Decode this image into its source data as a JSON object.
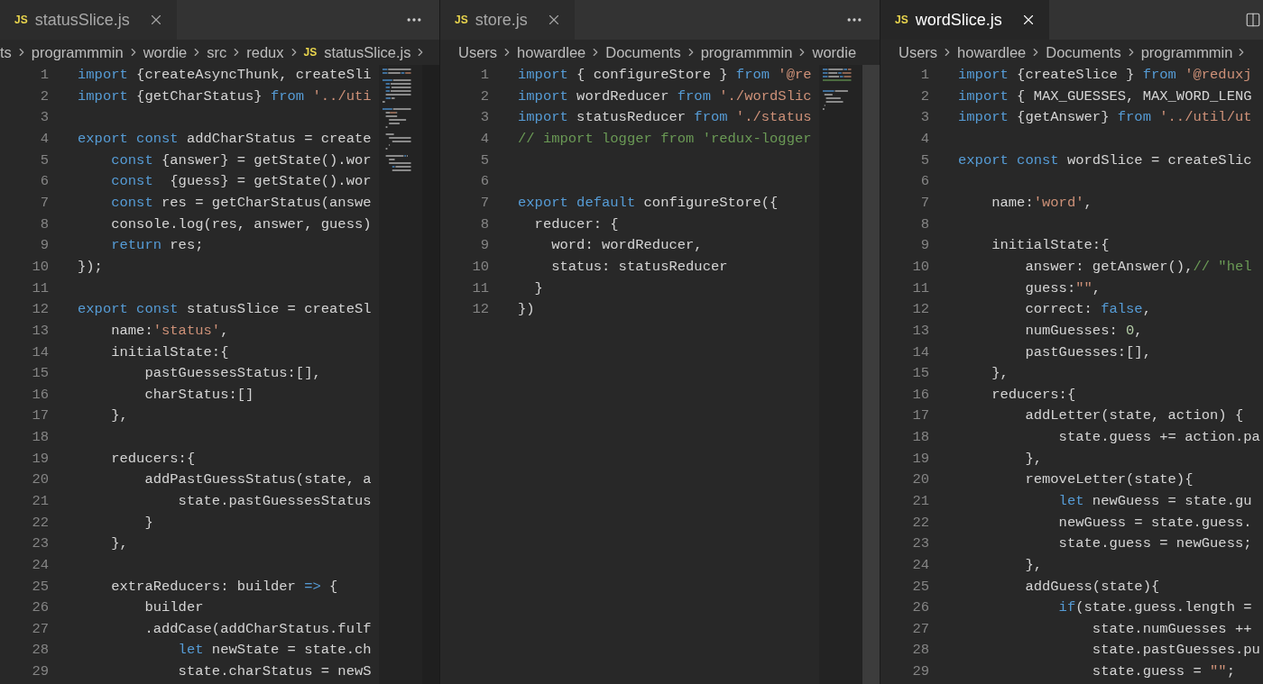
{
  "panes": [
    {
      "tab": {
        "badge": "JS",
        "label": "statusSlice.js",
        "focused": false
      },
      "action": {
        "kind": "more"
      },
      "minimap": true,
      "breadcrumb": [
        {
          "text": "ts"
        },
        {
          "text": "programmmin"
        },
        {
          "text": "wordie"
        },
        {
          "text": "src"
        },
        {
          "text": "redux"
        },
        {
          "text": "statusSlice.js",
          "kind": "file",
          "badge": "JS"
        }
      ],
      "trailing_chevron": true,
      "lines": [
        {
          "number": "1",
          "tokens": [
            {
              "kind": "keyword",
              "text": "import"
            },
            {
              "kind": "plain",
              "text": " {createAsyncThunk, createSli"
            }
          ]
        },
        {
          "number": "2",
          "tokens": [
            {
              "kind": "keyword",
              "text": "import"
            },
            {
              "kind": "plain",
              "text": " {getCharStatus} "
            },
            {
              "kind": "keyword",
              "text": "from"
            },
            {
              "kind": "string",
              "text": " '../uti"
            }
          ]
        },
        {
          "number": "3"
        },
        {
          "number": "4",
          "tokens": [
            {
              "kind": "keyword",
              "text": "export const"
            },
            {
              "kind": "plain",
              "text": " addCharStatus = create"
            }
          ]
        },
        {
          "number": "5",
          "tokens": [
            {
              "kind": "keyword",
              "text": "    const"
            },
            {
              "kind": "plain",
              "text": " {answer} = getState().wor"
            }
          ]
        },
        {
          "number": "6",
          "tokens": [
            {
              "kind": "keyword",
              "text": "    const"
            },
            {
              "kind": "plain",
              "text": "  {guess} = getState().wor"
            }
          ]
        },
        {
          "number": "7",
          "tokens": [
            {
              "kind": "keyword",
              "text": "    const"
            },
            {
              "kind": "plain",
              "text": " res = getCharStatus(answe"
            }
          ]
        },
        {
          "number": "8",
          "tokens": [
            {
              "kind": "plain",
              "text": "    console.log(res, answer, guess)"
            }
          ]
        },
        {
          "number": "9",
          "tokens": [
            {
              "kind": "keyword",
              "text": "    return"
            },
            {
              "kind": "plain",
              "text": " res;"
            }
          ]
        },
        {
          "number": "10",
          "tokens": [
            {
              "kind": "plain",
              "text": "});"
            }
          ]
        },
        {
          "number": "11"
        },
        {
          "number": "12",
          "tokens": [
            {
              "kind": "keyword",
              "text": "export const"
            },
            {
              "kind": "plain",
              "text": " statusSlice = createSl"
            }
          ]
        },
        {
          "number": "13",
          "tokens": [
            {
              "kind": "plain",
              "text": "    name:"
            },
            {
              "kind": "string",
              "text": "'status'"
            },
            {
              "kind": "plain",
              "text": ","
            }
          ]
        },
        {
          "number": "14",
          "tokens": [
            {
              "kind": "plain",
              "text": "    initialState:{"
            }
          ]
        },
        {
          "number": "15",
          "tokens": [
            {
              "kind": "plain",
              "text": "        pastGuessesStatus:[],"
            }
          ]
        },
        {
          "number": "16",
          "tokens": [
            {
              "kind": "plain",
              "text": "        charStatus:[]"
            }
          ]
        },
        {
          "number": "17",
          "tokens": [
            {
              "kind": "plain",
              "text": "    },"
            }
          ]
        },
        {
          "number": "18"
        },
        {
          "number": "19",
          "tokens": [
            {
              "kind": "plain",
              "text": "    reducers:{"
            }
          ]
        },
        {
          "number": "20",
          "tokens": [
            {
              "kind": "plain",
              "text": "        addPastGuessStatus(state, a"
            }
          ]
        },
        {
          "number": "21",
          "tokens": [
            {
              "kind": "plain",
              "text": "            state.pastGuessesStatus"
            }
          ]
        },
        {
          "number": "22",
          "tokens": [
            {
              "kind": "plain",
              "text": "        }"
            }
          ]
        },
        {
          "number": "23",
          "tokens": [
            {
              "kind": "plain",
              "text": "    },"
            }
          ]
        },
        {
          "number": "24"
        },
        {
          "number": "25",
          "tokens": [
            {
              "kind": "plain",
              "text": "    extraReducers: builder "
            },
            {
              "kind": "keyword",
              "text": "=>"
            },
            {
              "kind": "plain",
              "text": " {"
            }
          ]
        },
        {
          "number": "26",
          "tokens": [
            {
              "kind": "plain",
              "text": "        builder"
            }
          ]
        },
        {
          "number": "27",
          "tokens": [
            {
              "kind": "plain",
              "text": "        .addCase(addCharStatus.fulf"
            }
          ]
        },
        {
          "number": "28",
          "tokens": [
            {
              "kind": "keyword",
              "text": "            let"
            },
            {
              "kind": "plain",
              "text": " newState = state.ch"
            }
          ]
        },
        {
          "number": "29",
          "tokens": [
            {
              "kind": "plain",
              "text": "            state.charStatus = newS"
            }
          ]
        }
      ]
    },
    {
      "tab": {
        "badge": "JS",
        "label": "store.js",
        "focused": false
      },
      "action": {
        "kind": "more"
      },
      "minimap": true,
      "breadcrumb": [
        {
          "text": "Users"
        },
        {
          "text": "howardlee"
        },
        {
          "text": "Documents"
        },
        {
          "text": "programmmin"
        },
        {
          "text": "wordie"
        }
      ],
      "trailing_chevron": false,
      "lines": [
        {
          "number": "1",
          "tokens": [
            {
              "kind": "keyword",
              "text": "import"
            },
            {
              "kind": "plain",
              "text": " { configureStore } "
            },
            {
              "kind": "keyword",
              "text": "from"
            },
            {
              "kind": "string",
              "text": " '@re"
            }
          ]
        },
        {
          "number": "2",
          "tokens": [
            {
              "kind": "keyword",
              "text": "import"
            },
            {
              "kind": "plain",
              "text": " wordReducer "
            },
            {
              "kind": "keyword",
              "text": "from"
            },
            {
              "kind": "string",
              "text": " './wordSlic"
            }
          ]
        },
        {
          "number": "3",
          "tokens": [
            {
              "kind": "keyword",
              "text": "import"
            },
            {
              "kind": "plain",
              "text": " statusReducer "
            },
            {
              "kind": "keyword",
              "text": "from"
            },
            {
              "kind": "string",
              "text": " './status"
            }
          ]
        },
        {
          "number": "4",
          "tokens": [
            {
              "kind": "comment",
              "text": "// import logger from 'redux-logger"
            }
          ]
        },
        {
          "number": "5"
        },
        {
          "number": "6"
        },
        {
          "number": "7",
          "tokens": [
            {
              "kind": "keyword",
              "text": "export default"
            },
            {
              "kind": "plain",
              "text": " configureStore({"
            }
          ]
        },
        {
          "number": "8",
          "tokens": [
            {
              "kind": "plain",
              "text": "  reducer: {"
            }
          ]
        },
        {
          "number": "9",
          "tokens": [
            {
              "kind": "plain",
              "text": "    word: wordReducer,"
            }
          ]
        },
        {
          "number": "10",
          "tokens": [
            {
              "kind": "plain",
              "text": "    status: statusReducer"
            }
          ]
        },
        {
          "number": "11",
          "tokens": [
            {
              "kind": "plain",
              "text": "  }"
            }
          ]
        },
        {
          "number": "12",
          "tokens": [
            {
              "kind": "plain",
              "text": "})"
            }
          ]
        }
      ]
    },
    {
      "tab": {
        "badge": "JS",
        "label": "wordSlice.js",
        "focused": true
      },
      "action": {
        "kind": "split"
      },
      "minimap": false,
      "breadcrumb": [
        {
          "text": "Users"
        },
        {
          "text": "howardlee"
        },
        {
          "text": "Documents"
        },
        {
          "text": "programmmin"
        }
      ],
      "trailing_chevron": true,
      "lines": [
        {
          "number": "1",
          "tokens": [
            {
              "kind": "keyword",
              "text": "import"
            },
            {
              "kind": "plain",
              "text": " {createSlice } "
            },
            {
              "kind": "keyword",
              "text": "from"
            },
            {
              "kind": "string",
              "text": " '@reduxj"
            }
          ]
        },
        {
          "number": "2",
          "tokens": [
            {
              "kind": "keyword",
              "text": "import"
            },
            {
              "kind": "plain",
              "text": " { MAX_GUESSES, MAX_WORD_LENG"
            }
          ]
        },
        {
          "number": "3",
          "tokens": [
            {
              "kind": "keyword",
              "text": "import"
            },
            {
              "kind": "plain",
              "text": " {getAnswer} "
            },
            {
              "kind": "keyword",
              "text": "from"
            },
            {
              "kind": "string",
              "text": " '../util/ut"
            }
          ]
        },
        {
          "number": "4"
        },
        {
          "number": "5",
          "tokens": [
            {
              "kind": "keyword",
              "text": "export const"
            },
            {
              "kind": "plain",
              "text": " wordSlice = createSlic"
            }
          ]
        },
        {
          "number": "6"
        },
        {
          "number": "7",
          "tokens": [
            {
              "kind": "plain",
              "text": "    name:"
            },
            {
              "kind": "string",
              "text": "'word'"
            },
            {
              "kind": "plain",
              "text": ","
            }
          ]
        },
        {
          "number": "8"
        },
        {
          "number": "9",
          "tokens": [
            {
              "kind": "plain",
              "text": "    initialState:{"
            }
          ]
        },
        {
          "number": "10",
          "tokens": [
            {
              "kind": "plain",
              "text": "        answer: getAnswer(),"
            },
            {
              "kind": "comment",
              "text": "// \"hel"
            }
          ]
        },
        {
          "number": "11",
          "tokens": [
            {
              "kind": "plain",
              "text": "        guess:"
            },
            {
              "kind": "string",
              "text": "\"\""
            },
            {
              "kind": "plain",
              "text": ","
            }
          ]
        },
        {
          "number": "12",
          "tokens": [
            {
              "kind": "plain",
              "text": "        correct: "
            },
            {
              "kind": "keyword",
              "text": "false"
            },
            {
              "kind": "plain",
              "text": ","
            }
          ]
        },
        {
          "number": "13",
          "tokens": [
            {
              "kind": "plain",
              "text": "        numGuesses: "
            },
            {
              "kind": "number",
              "text": "0"
            },
            {
              "kind": "plain",
              "text": ","
            }
          ]
        },
        {
          "number": "14",
          "tokens": [
            {
              "kind": "plain",
              "text": "        pastGuesses:[],"
            }
          ]
        },
        {
          "number": "15",
          "tokens": [
            {
              "kind": "plain",
              "text": "    },"
            }
          ]
        },
        {
          "number": "16",
          "tokens": [
            {
              "kind": "plain",
              "text": "    reducers:{"
            }
          ]
        },
        {
          "number": "17",
          "tokens": [
            {
              "kind": "plain",
              "text": "        addLetter(state, action) {"
            }
          ]
        },
        {
          "number": "18",
          "tokens": [
            {
              "kind": "plain",
              "text": "            state.guess += action.pa"
            }
          ]
        },
        {
          "number": "19",
          "tokens": [
            {
              "kind": "plain",
              "text": "        },"
            }
          ]
        },
        {
          "number": "20",
          "tokens": [
            {
              "kind": "plain",
              "text": "        removeLetter(state){"
            }
          ]
        },
        {
          "number": "21",
          "tokens": [
            {
              "kind": "keyword",
              "text": "            let"
            },
            {
              "kind": "plain",
              "text": " newGuess = state.gu"
            }
          ]
        },
        {
          "number": "22",
          "tokens": [
            {
              "kind": "plain",
              "text": "            newGuess = state.guess."
            }
          ]
        },
        {
          "number": "23",
          "tokens": [
            {
              "kind": "plain",
              "text": "            state.guess = newGuess;"
            }
          ]
        },
        {
          "number": "24",
          "tokens": [
            {
              "kind": "plain",
              "text": "        },"
            }
          ]
        },
        {
          "number": "25",
          "tokens": [
            {
              "kind": "plain",
              "text": "        addGuess(state){"
            }
          ]
        },
        {
          "number": "26",
          "tokens": [
            {
              "kind": "keyword",
              "text": "            if"
            },
            {
              "kind": "plain",
              "text": "(state.guess.length ="
            }
          ]
        },
        {
          "number": "27",
          "tokens": [
            {
              "kind": "plain",
              "text": "                state.numGuesses ++"
            }
          ]
        },
        {
          "number": "28",
          "tokens": [
            {
              "kind": "plain",
              "text": "                state.pastGuesses.pu"
            }
          ]
        },
        {
          "number": "29",
          "tokens": [
            {
              "kind": "plain",
              "text": "                state.guess = "
            },
            {
              "kind": "string",
              "text": "\"\""
            },
            {
              "kind": "plain",
              "text": ";"
            }
          ]
        }
      ]
    }
  ]
}
